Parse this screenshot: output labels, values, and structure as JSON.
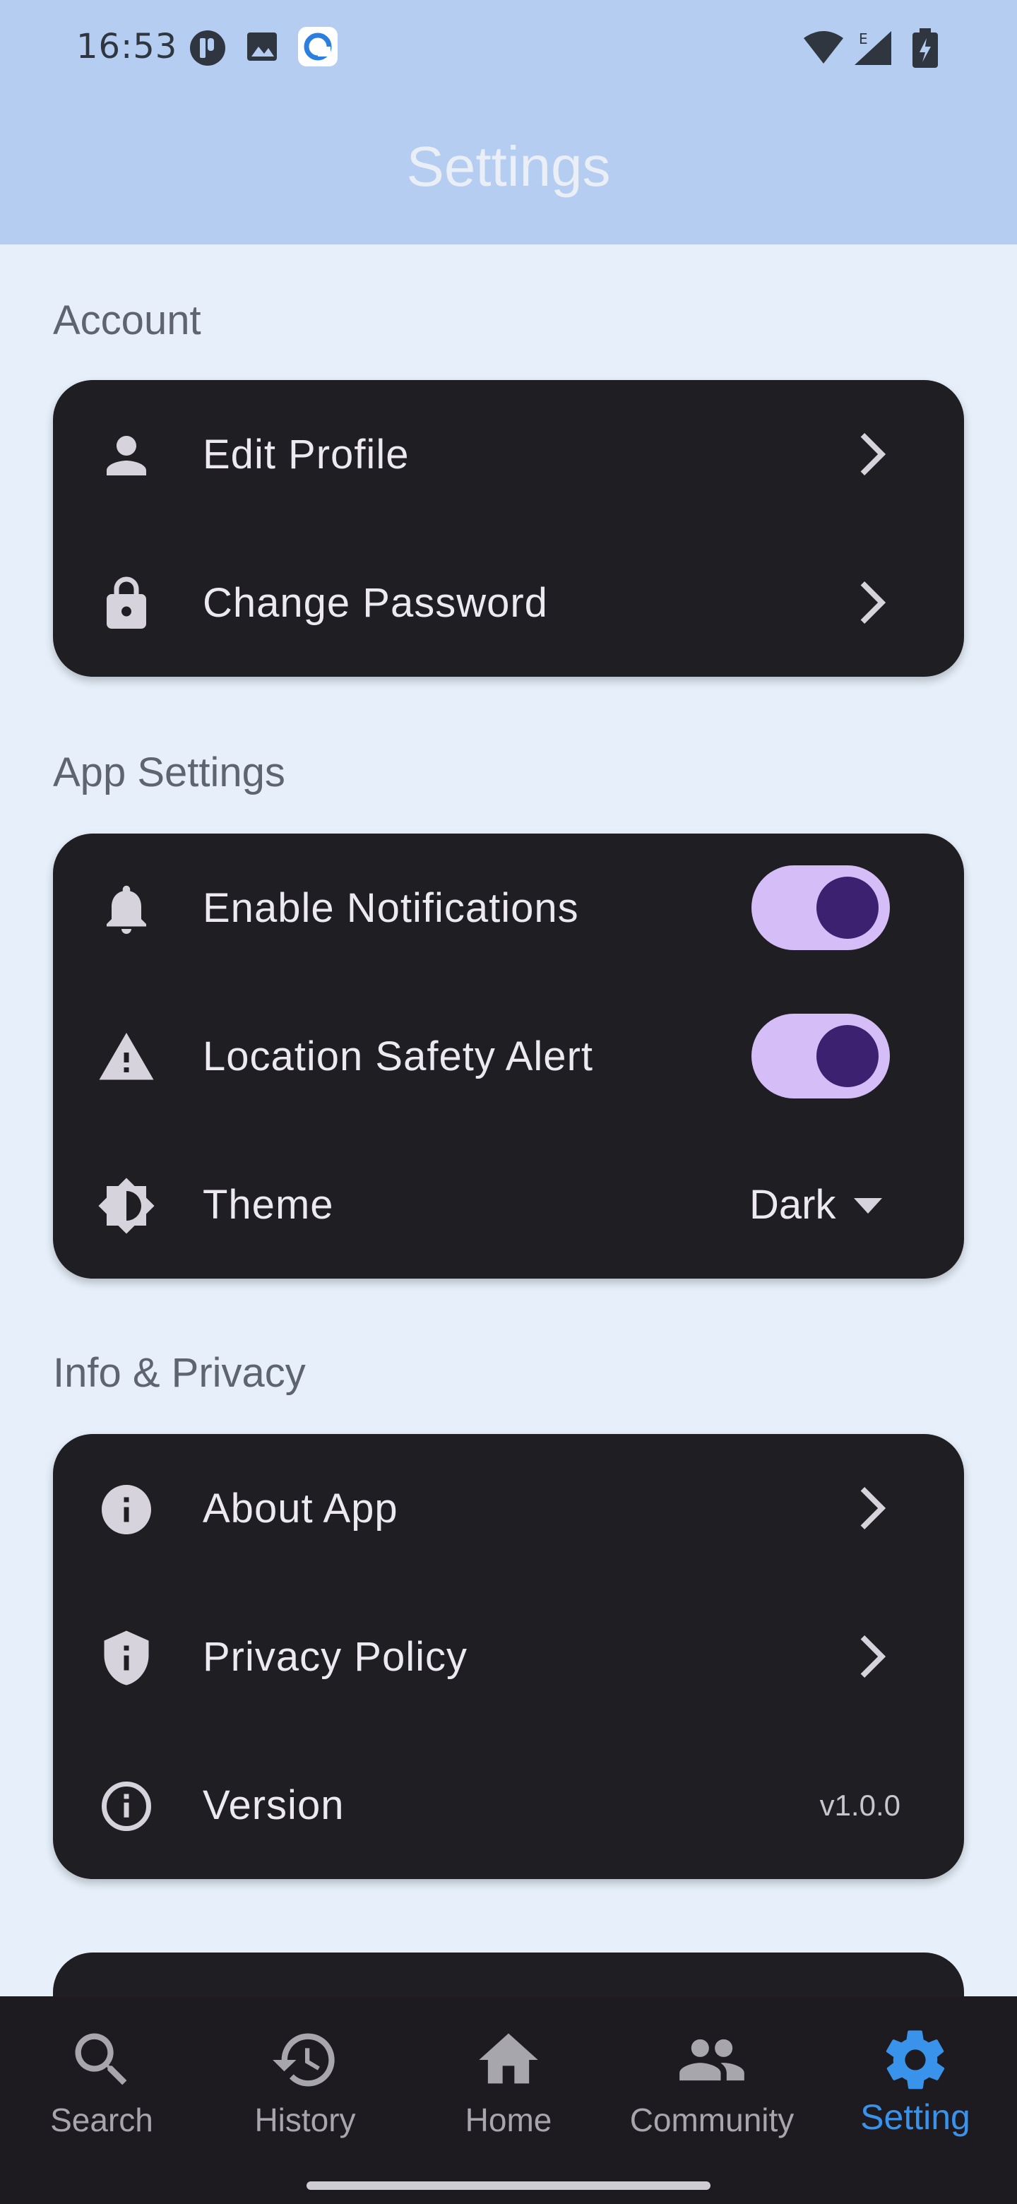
{
  "status_bar": {
    "time": "16:53"
  },
  "app_bar": {
    "title": "Settings"
  },
  "sections": {
    "account": {
      "label": "Account",
      "items": [
        {
          "label": "Edit Profile",
          "icon": "person-icon"
        },
        {
          "label": "Change Password",
          "icon": "lock-icon"
        }
      ]
    },
    "app_settings": {
      "label": "App Settings",
      "items": [
        {
          "label": "Enable Notifications",
          "icon": "bell-icon",
          "toggle_on": true
        },
        {
          "label": "Location Safety Alert",
          "icon": "warning-icon",
          "toggle_on": true
        },
        {
          "label": "Theme",
          "icon": "brightness-icon",
          "value": "Dark"
        }
      ]
    },
    "info_privacy": {
      "label": "Info & Privacy",
      "items": [
        {
          "label": "About App",
          "icon": "info-icon"
        },
        {
          "label": "Privacy Policy",
          "icon": "shield-icon"
        },
        {
          "label": "Version",
          "icon": "info-outline-icon",
          "value": "v1.0.0"
        }
      ]
    }
  },
  "bottom_nav": {
    "items": [
      {
        "label": "Search",
        "icon": "search-icon",
        "active": false
      },
      {
        "label": "History",
        "icon": "history-icon",
        "active": false
      },
      {
        "label": "Home",
        "icon": "home-icon",
        "active": false
      },
      {
        "label": "Community",
        "icon": "people-icon",
        "active": false
      },
      {
        "label": "Setting",
        "icon": "gear-icon",
        "active": true
      }
    ]
  },
  "colors": {
    "app_bar": "#b4cdf0",
    "background": "#e6effa",
    "card": "#1f1e22",
    "toggle_track": "#d5bdf7",
    "toggle_knob": "#3b2170",
    "active_nav": "#3a93ea"
  }
}
